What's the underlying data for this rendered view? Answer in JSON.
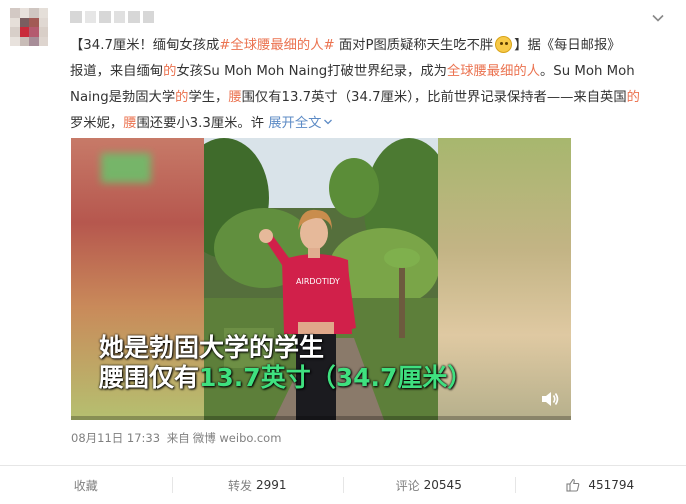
{
  "header": {
    "more_icon": "chevron-down-icon"
  },
  "post": {
    "line1": {
      "prefix": "【34.7厘米！缅甸女孩成",
      "topic": "#全球腰最细的人#",
      "middle": " 面对P图质疑称天生吃不胖",
      "suffix": "】据",
      "source": "《每日邮报》"
    },
    "line2": {
      "a": "报道，来自缅甸",
      "b": "的",
      "c": "女孩Su Moh Moh Naing打破世界纪录，成为",
      "d": "全球腰最细的人",
      "e": "。Su Moh Moh"
    },
    "line3": {
      "a": "Naing是勃固大学",
      "b": "的",
      "c": "学生，",
      "d": "腰",
      "e": "围仅有13.7英寸（34.7厘米），比前世界记录保持者——来自英国",
      "f": "的"
    },
    "line4": {
      "a": "罗米妮，",
      "b": "腰",
      "c": "围还要小3.3厘米。许",
      "expand": "展开全文",
      "expand_icon": "chevron-down-icon"
    }
  },
  "video": {
    "caption_line1": "她是勃固大学的学生",
    "caption_line2_white": "腰围仅有",
    "caption_line2_green": "13.7英寸（34.7厘米）",
    "volume_icon": "volume-icon"
  },
  "meta": {
    "date": "08月11日 17:33",
    "from_label": "来自",
    "source": "微博 weibo.com"
  },
  "footer": {
    "favorite_label": "收藏",
    "repost_label": "转发",
    "repost_count": "2991",
    "comment_label": "评论",
    "comment_count": "20545",
    "like_icon": "thumbs-up-icon",
    "like_count": "451794"
  },
  "colors": {
    "highlight": "#eb7350",
    "link_blue": "#5d8bc5",
    "caption_green": "#3fe07f",
    "muted": "#808080"
  }
}
